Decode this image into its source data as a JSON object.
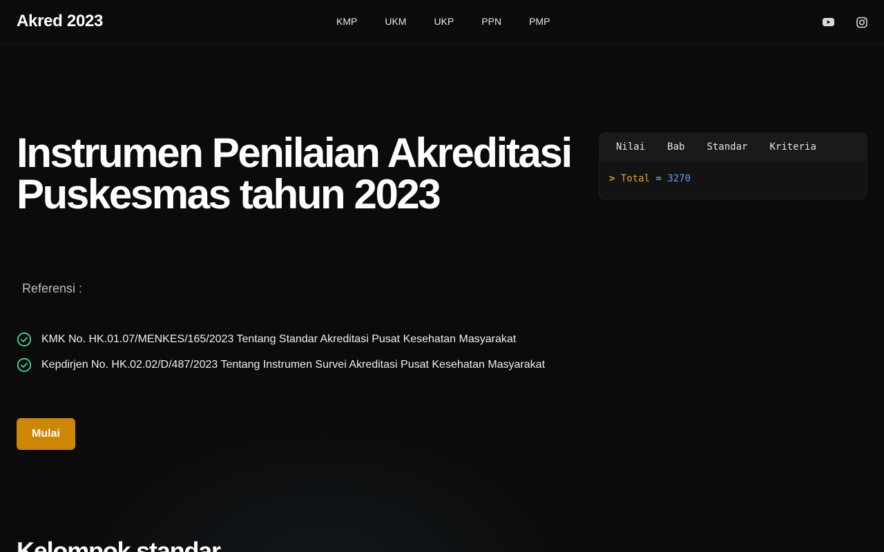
{
  "header": {
    "brand": "Akred 2023",
    "nav": [
      "KMP",
      "UKM",
      "UKP",
      "PPN",
      "PMP"
    ],
    "social": [
      "youtube-icon",
      "instagram-icon"
    ]
  },
  "hero": {
    "title": "Instrumen Penilaian Akreditasi Puskesmas tahun 2023",
    "referensi_label": "Referensi :",
    "references": [
      "KMK No. HK.01.07/MENKES/165/2023 Tentang Standar Akreditasi Pusat Kesehatan Masyarakat",
      "Kepdirjen No. HK.02.02/D/487/2023 Tentang Instrumen Survei Akreditasi Pusat Kesehatan Masyarakat"
    ],
    "start_button": "Mulai"
  },
  "panel": {
    "tabs": [
      "Nilai",
      "Bab",
      "Standar",
      "Kriteria"
    ],
    "prompt": ">",
    "key": "Total",
    "operator": "=",
    "value": "3270"
  },
  "section": {
    "title": "Kelompok standar"
  },
  "colors": {
    "background": "#0b0b0c",
    "accent": "#cd8606",
    "check": "#3ddc97",
    "code_key": "#f4a01c",
    "code_value": "#5ea0f0"
  }
}
